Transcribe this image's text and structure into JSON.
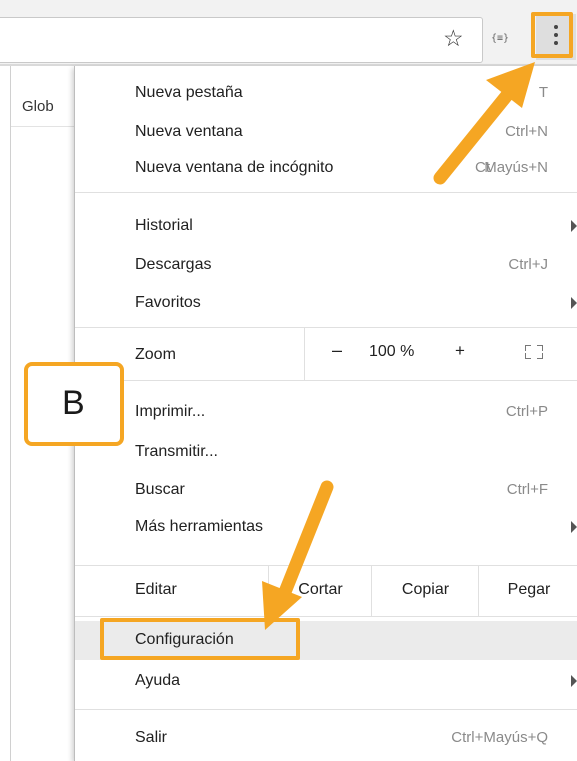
{
  "accent": "#f5a623",
  "page": {
    "partial_text": "Glob"
  },
  "toolbar": {
    "star_icon": "☆",
    "ext_icon": "{≡}"
  },
  "menu": {
    "new_tab": {
      "label": "Nueva pestaña",
      "shortcut": "T"
    },
    "new_window": {
      "label": "Nueva ventana",
      "shortcut": "Ctrl+N"
    },
    "incognito": {
      "label": "Nueva ventana de incógnito",
      "shortcut": "Mayús+N",
      "shortcut_prefix": "Ct"
    },
    "history": {
      "label": "Historial"
    },
    "downloads": {
      "label": "Descargas",
      "shortcut": "Ctrl+J"
    },
    "bookmarks": {
      "label": "Favoritos"
    },
    "zoom": {
      "label": "Zoom",
      "minus": "–",
      "value": "100 %",
      "plus": "+"
    },
    "print": {
      "label": "Imprimir...",
      "shortcut": "Ctrl+P"
    },
    "cast": {
      "label": "Transmitir..."
    },
    "find": {
      "label": "Buscar",
      "shortcut": "Ctrl+F"
    },
    "more_tools": {
      "label": "Más herramientas"
    },
    "edit": {
      "label": "Editar",
      "cut": "Cortar",
      "copy": "Copiar",
      "paste": "Pegar"
    },
    "settings": {
      "label": "Configuración"
    },
    "help": {
      "label": "Ayuda"
    },
    "exit": {
      "label": "Salir",
      "shortcut": "Ctrl+Mayús+Q"
    }
  },
  "annotation": {
    "step_label": "B"
  }
}
